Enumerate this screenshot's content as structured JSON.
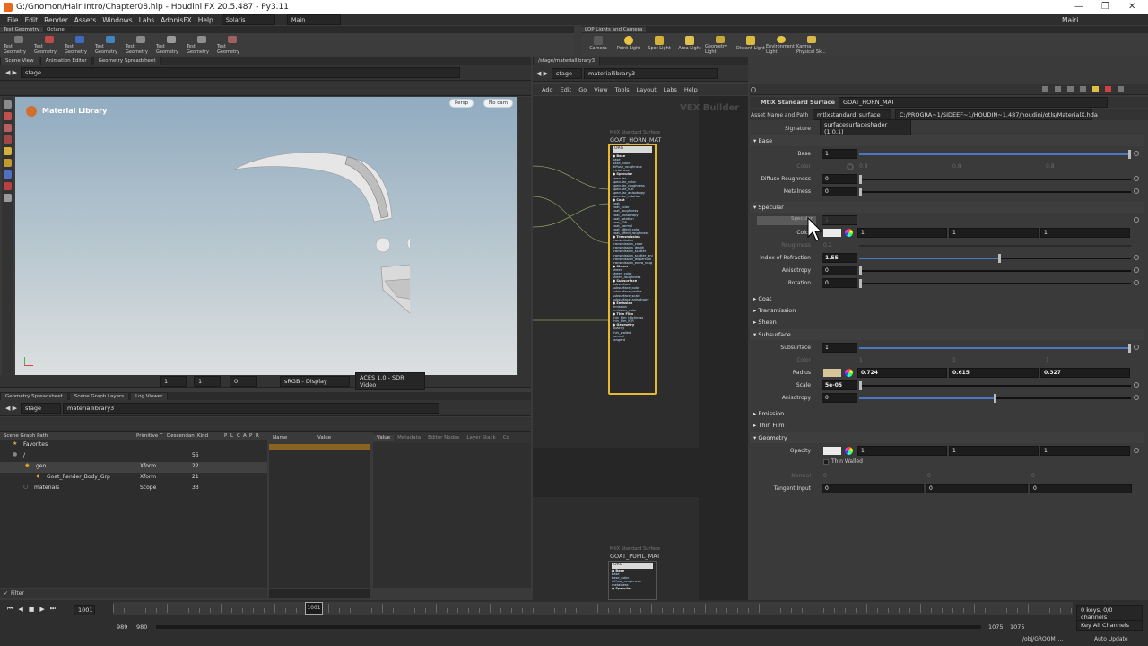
{
  "window": {
    "title": "G:/Gnomon/Hair Intro/Chapter08.hip - Houdini FX 20.5.487 - Py3.11"
  },
  "menu": {
    "items": [
      "File",
      "Edit",
      "Render",
      "Assets",
      "Windows",
      "Labs",
      "AdonisFX",
      "Help"
    ],
    "desktop": "Solaris",
    "context": "Main",
    "user": "Mairi"
  },
  "shelf_left": {
    "tabs": [
      "Test Geometry",
      "Octane"
    ],
    "tools": [
      "Test Geometry",
      "Test Geometry",
      "Test Geometry",
      "Test Geometry",
      "Test Geometry",
      "Test Geometry",
      "Test Geometry",
      "Test Geometry"
    ]
  },
  "shelf_right": {
    "tabs": [
      "LOP Lights and Camera"
    ],
    "tools": [
      "Camera",
      "Point Light",
      "Spot Light",
      "Area Light",
      "Geometry Light",
      "Distant Light",
      "Environment Light",
      "Karma Physical Sk..."
    ]
  },
  "viewer": {
    "tabs": [
      "Scene View",
      "Animation Editor",
      "Geometry Spreadsheet"
    ],
    "path": "stage",
    "heading": "Material Library",
    "persp": "Persp",
    "cam": "No cam",
    "bottom": {
      "frame_a": "1",
      "frame_b": "1",
      "frame_c": "0",
      "display": "sRGB - Display",
      "view": "ACES 1.0 - SDR Video"
    }
  },
  "network": {
    "url": "/stage/materiallibrary3",
    "path_a": "stage",
    "path_b": "materiallibrary3",
    "menu": [
      "Add",
      "Edit",
      "Go",
      "View",
      "Tools",
      "Layout",
      "Labs",
      "Help"
    ],
    "watermark": "VEX Builder",
    "node1": {
      "type": "MtlX Standard Surface",
      "name": "GOAT_HORN_MAT",
      "header": "ORG"
    },
    "node2": {
      "type": "MtlX Standard Surface",
      "name": "GOAT_PUPIL_MAT",
      "header": "ORG"
    }
  },
  "params": {
    "node_type": "MtlX Standard Surface",
    "node_name": "GOAT_HORN_MAT",
    "asset_label": "Asset Name and Path",
    "asset_name": "mtlxstandard_surface",
    "asset_path": "C:/PROGRA~1/SIDEEF~1/HOUDIN~1.487/houdini/otls/MaterialX.hda",
    "signature_label": "Signature",
    "signature": "surfacesurfaceshader (1.0.1)",
    "sections": {
      "base": "Base",
      "specular": "Specular",
      "coat": "Coat",
      "transmission": "Transmission",
      "sheen": "Sheen",
      "subsurface": "Subsurface",
      "emission": "Emission",
      "thinfilm": "Thin Film",
      "geometry": "Geometry"
    },
    "base": [
      {
        "label": "Base",
        "value": "1"
      },
      {
        "label": "Color",
        "v1": "0.8",
        "v2": "0.8",
        "v3": "0.8"
      },
      {
        "label": "Diffuse Roughness",
        "value": "0"
      },
      {
        "label": "Metalness",
        "value": "0"
      }
    ],
    "specular": [
      {
        "label": "Specular",
        "value": "1"
      },
      {
        "label": "Color",
        "v1": "1",
        "v2": "1",
        "v3": "1"
      },
      {
        "label": "Roughness",
        "value": "0.2"
      },
      {
        "label": "Index of Refraction",
        "value": "1.55"
      },
      {
        "label": "Anisotropy",
        "value": "0"
      },
      {
        "label": "Rotation",
        "value": "0"
      }
    ],
    "subsurface": [
      {
        "label": "Subsurface",
        "value": "1"
      },
      {
        "label": "Color",
        "v1": "1",
        "v2": "1",
        "v3": "1"
      },
      {
        "label": "Radius",
        "v1": "0.724",
        "v2": "0.615",
        "v3": "0.327"
      },
      {
        "label": "Scale",
        "value": "5e-05"
      },
      {
        "label": "Anisotropy",
        "value": "0"
      }
    ],
    "geometry": [
      {
        "label": "Opacity",
        "v1": "1",
        "v2": "1",
        "v3": "1"
      },
      {
        "label": "Thin Walled"
      },
      {
        "label": "Normal",
        "v1": "0",
        "v2": "0",
        "v3": "0"
      },
      {
        "label": "Tangent Input",
        "v1": "0",
        "v2": "0",
        "v3": "0"
      }
    ]
  },
  "scenegraph": {
    "tabs": [
      "Geometry Spreadsheet",
      "Scene Graph Layers",
      "Log Viewer"
    ],
    "path_a": "stage",
    "path_b": "materiallibrary3",
    "columns": [
      "Scene Graph Path",
      "Primitive T",
      "Descendan",
      "Kind",
      "P",
      "L",
      "C",
      "A",
      "P",
      "R"
    ],
    "rows": [
      {
        "name": "Favorites",
        "type": "",
        "count": ""
      },
      {
        "name": "/",
        "type": "",
        "count": "55"
      },
      {
        "name": "geo",
        "type": "Xform",
        "count": "22"
      },
      {
        "name": "Goat_Render_Body_Grp",
        "type": "Xform",
        "count": "21"
      },
      {
        "name": "materials",
        "type": "Scope",
        "count": "33"
      }
    ],
    "filter": "Filter",
    "detail_cols": [
      "Name",
      "Value"
    ],
    "detail_tabs": [
      "Value",
      "Metadata",
      "Editor Nodes",
      "Layer Stack",
      "Co"
    ]
  },
  "timeline": {
    "frame": "1001",
    "current": "1001",
    "start_a": "989",
    "start_b": "980",
    "end_a": "1075",
    "end_b": "1075",
    "keys": "0 keys, 0/0 channels",
    "key_all": "Key All Channels",
    "job": "/obj/GROOM_...",
    "auto_update": "Auto Update"
  }
}
